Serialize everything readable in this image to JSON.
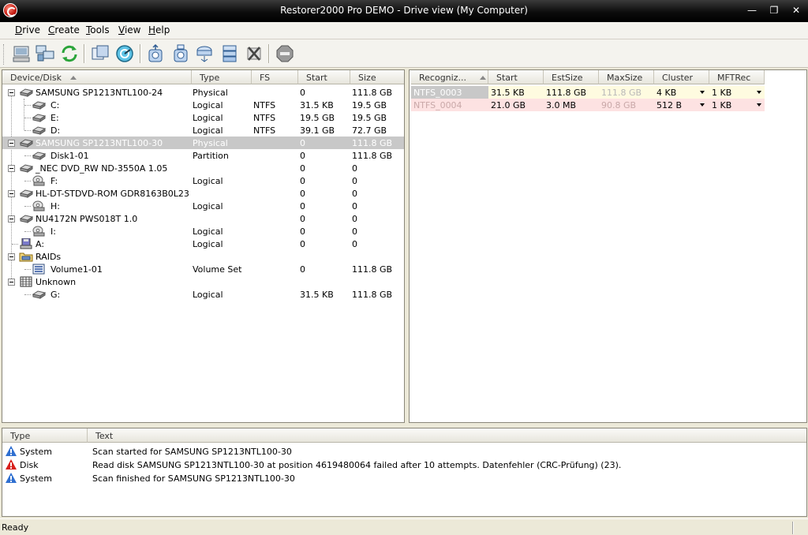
{
  "window": {
    "title": "Restorer2000 Pro DEMO - Drive view (My Computer)"
  },
  "menu": [
    "Drive",
    "Create",
    "Tools",
    "View",
    "Help"
  ],
  "toolbar": {
    "buttons": [
      "computer-icon",
      "network-icon",
      "refresh-icon",
      "copy-disk-icon",
      "scan-icon",
      "open-drive-icon",
      "create-image-icon",
      "create-region-icon",
      "create-raid-icon",
      "remove-icon",
      "stop-icon"
    ]
  },
  "devices": {
    "headers": {
      "device": "Device/Disk",
      "type": "Type",
      "fs": "FS",
      "start": "Start",
      "size": "Size"
    },
    "rows": [
      {
        "name": "SAMSUNG SP1213NTL100-24",
        "type": "Physical",
        "fs": "",
        "start": "0",
        "size": "111.8 GB"
      },
      {
        "name": "C:",
        "type": "Logical",
        "fs": "NTFS",
        "start": "31.5 KB",
        "size": "19.5 GB"
      },
      {
        "name": "E:",
        "type": "Logical",
        "fs": "NTFS",
        "start": "19.5 GB",
        "size": "19.5 GB"
      },
      {
        "name": "D:",
        "type": "Logical",
        "fs": "NTFS",
        "start": "39.1 GB",
        "size": "72.7 GB"
      },
      {
        "name": "SAMSUNG SP1213NTL100-30",
        "type": "Physical",
        "fs": "",
        "start": "0",
        "size": "111.8 GB"
      },
      {
        "name": "Disk1-01",
        "type": "Partition",
        "fs": "",
        "start": "0",
        "size": "111.8 GB"
      },
      {
        "name": "_NEC DVD_RW ND-3550A 1.05",
        "type": "",
        "fs": "",
        "start": "0",
        "size": "0"
      },
      {
        "name": "F:",
        "type": "Logical",
        "fs": "",
        "start": "0",
        "size": "0"
      },
      {
        "name": "HL-DT-STDVD-ROM GDR8163B0L23",
        "type": "",
        "fs": "",
        "start": "0",
        "size": "0"
      },
      {
        "name": "H:",
        "type": "Logical",
        "fs": "",
        "start": "0",
        "size": "0"
      },
      {
        "name": "NU4172N PWS018T 1.0",
        "type": "",
        "fs": "",
        "start": "0",
        "size": "0"
      },
      {
        "name": "I:",
        "type": "Logical",
        "fs": "",
        "start": "0",
        "size": "0"
      },
      {
        "name": "A:",
        "type": "Logical",
        "fs": "",
        "start": "0",
        "size": "0"
      },
      {
        "name": "RAIDs",
        "type": "",
        "fs": "",
        "start": "",
        "size": ""
      },
      {
        "name": "Volume1-01",
        "type": "Volume Set",
        "fs": "",
        "start": "0",
        "size": "111.8 GB"
      },
      {
        "name": "Unknown",
        "type": "",
        "fs": "",
        "start": "",
        "size": ""
      },
      {
        "name": "G:",
        "type": "Logical",
        "fs": "",
        "start": "31.5 KB",
        "size": "111.8 GB"
      }
    ]
  },
  "recognized": {
    "headers": {
      "name": "Recogniz...",
      "start": "Start",
      "est": "EstSize",
      "max": "MaxSize",
      "cluster": "Cluster",
      "mft": "MFTRec"
    },
    "rows": [
      {
        "name": "NTFS_0003",
        "start": "31.5 KB",
        "est": "111.8 GB",
        "max": "111.8 GB",
        "cluster": "4 KB",
        "mft": "1 KB"
      },
      {
        "name": "NTFS_0004",
        "start": "21.0 GB",
        "est": "3.0 MB",
        "max": "90.8 GB",
        "cluster": "512 B",
        "mft": "1 KB"
      }
    ]
  },
  "log": {
    "headers": {
      "type": "Type",
      "text": "Text"
    },
    "rows": [
      {
        "type": "System",
        "text": "Scan started for SAMSUNG SP1213NTL100-30",
        "level": "info"
      },
      {
        "type": "Disk",
        "text": "Read disk SAMSUNG SP1213NTL100-30 at position 4619480064 failed after 10 attempts. Datenfehler (CRC-Prüfung) (23).",
        "level": "error"
      },
      {
        "type": "System",
        "text": "Scan finished for SAMSUNG SP1213NTL100-30",
        "level": "info"
      }
    ]
  },
  "status": {
    "text": "Ready"
  },
  "colors": {
    "accent_error": "#d8201c",
    "accent_info": "#2f6fd0",
    "selected_row": "#c8c8c8",
    "ntfs3_bg": "#fefbe0",
    "ntfs4_bg": "#fde2e2"
  }
}
